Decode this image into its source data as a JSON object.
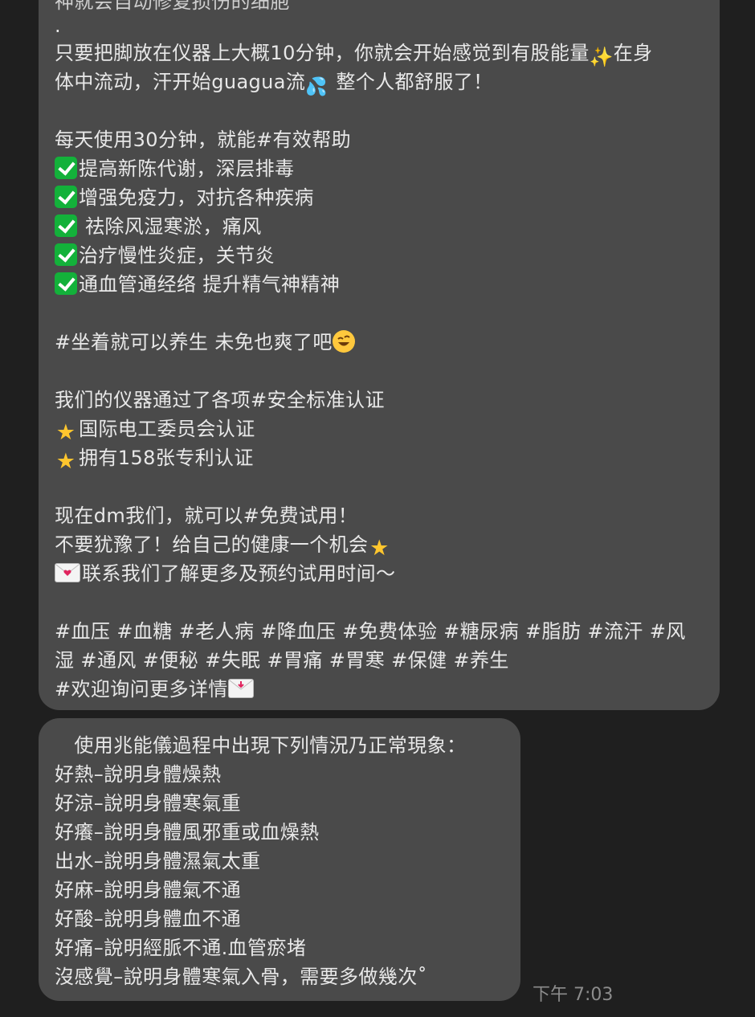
{
  "message1": {
    "partial_top": "神就会自动修复损伤的细胞",
    "dot": ".",
    "l1": "只要把脚放在仪器上大概10分钟，你就会开始感觉到有股能量",
    "l1b": "在身",
    "l2a": "体中流动，汗开始guagua流",
    "l2b": " 整个人都舒服了！",
    "l3": "每天使用30分钟，就能#有效帮助",
    "benefits": [
      "提高新陈代谢，深层排毒",
      "增强免疫力，对抗各种疾病",
      " 祛除风湿寒淤，痛风",
      "治疗慢性炎症，关节炎",
      "通血管通经络 提升精气神精神"
    ],
    "l4": "#坐着就可以养生 未免也爽了吧",
    "l5": "我们的仪器通过了各项#安全标准认证",
    "certs": [
      "国际电工委员会认证",
      "拥有158张专利认证"
    ],
    "l6": "现在dm我们，就可以#免费试用！",
    "l7": "不要犹豫了！给自己的健康一个机会",
    "l8": "联系我们了解更多及预约试用时间～",
    "tags1": "#血压 #血糖 #老人病 #降血压 #免费体验 #糖尿病 #脂肪 #流汗 #风",
    "tags2": "湿 #通风 #便秘 #失眠 #胃痛 #胃寒 #保健 #养生",
    "tags3": "#欢迎询问更多详情"
  },
  "message2": {
    "lines": [
      "　使用兆能儀過程中出現下列情況乃正常現象：",
      "好熱–說明身體燥熱",
      "好涼–說明身體寒氣重",
      "好癢–說明身體風邪重或血燥熱",
      "出水–說明身體濕氣太重",
      "好麻–說明身體氣不通",
      "好酸–說明身體血不通",
      "好痛–說明經脈不通.血管瘀堵",
      "沒感覺–說明身體寒氣入骨，需要多做幾次˚"
    ]
  },
  "timestamp": "下午 7:03",
  "icons": {
    "check": "check-mark-button-icon",
    "star": "glowing-star-icon",
    "sparkles": "sparkles-icon",
    "drops": "sweat-droplets-icon",
    "laugh": "rolling-laughing-face-icon",
    "envelope": "love-letter-icon",
    "incoming": "incoming-envelope-icon"
  },
  "colors": {
    "background": "#1f1f1f",
    "bubble": "#4a4a4a",
    "check_green": "#13b13a",
    "star_yellow": "#ffc62e"
  }
}
